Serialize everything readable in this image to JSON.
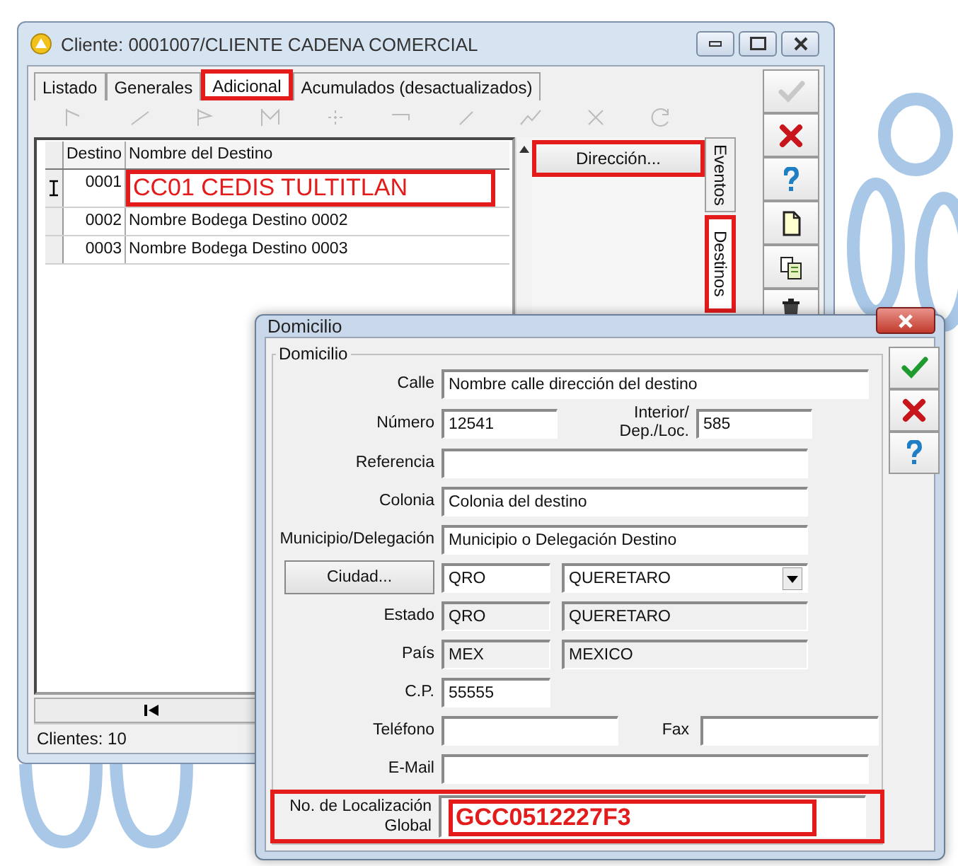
{
  "window": {
    "title": "Cliente: 0001007/CLIENTE CADENA COMERCIAL"
  },
  "tabs": [
    {
      "label": "Listado",
      "selected": false,
      "highlighted": false
    },
    {
      "label": "Generales",
      "selected": false,
      "highlighted": false
    },
    {
      "label": "Adicional",
      "selected": true,
      "highlighted": true
    },
    {
      "label": "Acumulados (desactualizados)",
      "selected": false,
      "highlighted": false
    }
  ],
  "grid": {
    "columns": [
      "Destino",
      "Nombre del Destino"
    ],
    "rows": [
      {
        "destino": "0001",
        "nombre": "CC01 CEDIS TULTITLAN",
        "current": true,
        "highlighted": true
      },
      {
        "destino": "0002",
        "nombre": "Nombre Bodega Destino 0002",
        "current": false,
        "highlighted": false
      },
      {
        "destino": "0003",
        "nombre": "Nombre Bodega Destino 0003",
        "current": false,
        "highlighted": false
      }
    ]
  },
  "direccion_button": {
    "label": "Dirección...",
    "highlighted": true
  },
  "side_tabs": [
    {
      "label": "Eventos",
      "selected": false,
      "highlighted": false
    },
    {
      "label": "Destinos",
      "selected": true,
      "highlighted": true
    }
  ],
  "toolbar_buttons": [
    {
      "kind": "accept",
      "disabled": true
    },
    {
      "kind": "cancel",
      "disabled": false
    },
    {
      "kind": "help",
      "disabled": false
    },
    {
      "kind": "new",
      "disabled": false
    },
    {
      "kind": "copy",
      "disabled": false
    },
    {
      "kind": "delete",
      "disabled": false
    }
  ],
  "status_bar": {
    "text": "Clientes: 10"
  },
  "dialog": {
    "title": "Domicilio",
    "group": "Domicilio",
    "buttons": [
      {
        "kind": "accept"
      },
      {
        "kind": "cancel"
      },
      {
        "kind": "help"
      }
    ],
    "form": [
      {
        "kind": "wide",
        "label": "Calle",
        "value": "Nombre calle dirección del destino",
        "highlighted": false
      },
      {
        "kind": "split",
        "label": "Número",
        "value": "12541",
        "label_2": "Interior/\nDep./Loc.",
        "value_2": "585",
        "highlighted": false
      },
      {
        "kind": "medium",
        "label": "Referencia",
        "highlighted": false
      },
      {
        "kind": "medium",
        "label": "Colonia",
        "value": "Colonia del destino",
        "highlighted": false
      },
      {
        "kind": "medium",
        "label": "Municipio/Delegación",
        "value": "Municipio o Delegación Destino",
        "highlighted": false
      },
      {
        "kind": "lookup",
        "button": "Ciudad...",
        "value": "QRO",
        "select": "QUERETARO",
        "highlighted": false
      },
      {
        "kind": "pair",
        "label": "Estado",
        "value": "QRO",
        "value_2": "QUERETARO",
        "disabled": true,
        "highlighted": false
      },
      {
        "kind": "pair",
        "label": "País",
        "value": "MEX",
        "value_2": "MEXICO",
        "disabled": true,
        "highlighted": false
      },
      {
        "kind": "short",
        "label": "C.P.",
        "value": "55555",
        "highlighted": false
      },
      {
        "kind": "phone",
        "label": "Teléfono",
        "label_2": "Fax",
        "highlighted": false
      },
      {
        "kind": "wide",
        "label": "E-Mail",
        "highlighted": false
      },
      {
        "kind": "wide",
        "label": "No. de Localización\nGlobal",
        "value": "GCC0512227F3",
        "highlighted": true
      }
    ]
  }
}
